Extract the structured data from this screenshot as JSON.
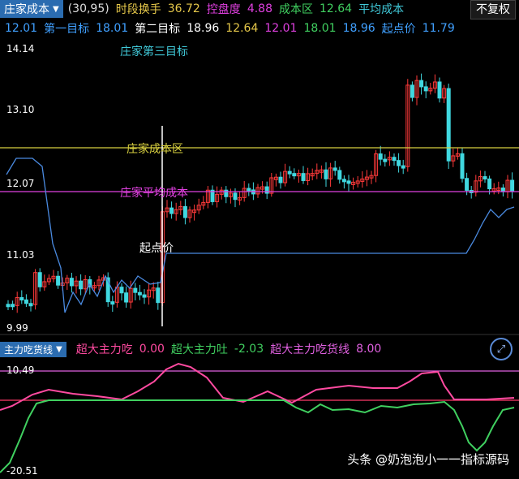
{
  "header": {
    "indicator_name": "庄家成本",
    "params": "(30,95)",
    "items": [
      {
        "label": "时段换手",
        "value": "36.72",
        "color": "#e6c84a"
      },
      {
        "label": "控盘度",
        "value": "4.88",
        "color": "#e040e0"
      },
      {
        "label": "成本区",
        "value": "12.64",
        "color": "#40d060"
      },
      {
        "label": "平均成本",
        "value": "",
        "color": "#40c8d8"
      }
    ],
    "adjust_button": "不复权"
  },
  "header2": {
    "items": [
      {
        "text": "12.01",
        "color": "#40a0ff"
      },
      {
        "text": "第一目标",
        "color": "#40a0ff"
      },
      {
        "text": "18.01",
        "color": "#40a0ff"
      },
      {
        "text": "第二目标",
        "color": "#ffffff"
      },
      {
        "text": "18.96",
        "color": "#ffffff"
      },
      {
        "text": "12.64",
        "color": "#e6c84a"
      },
      {
        "text": "12.01",
        "color": "#e040e0"
      },
      {
        "text": "18.01",
        "color": "#40d060"
      },
      {
        "text": "18.96",
        "color": "#40a0ff"
      },
      {
        "text": "起点价",
        "color": "#40a0ff"
      },
      {
        "text": "11.79",
        "color": "#40a0ff"
      }
    ]
  },
  "price_axis": {
    "top": "14.14",
    "l2": "13.10",
    "l3": "12.07",
    "l4": "11.03",
    "bottom": "9.99"
  },
  "annotations": {
    "third_target": "庄家第三目标",
    "cost_zone": "庄家成本区",
    "avg_cost": "庄家平均成本",
    "start_price": "起点价"
  },
  "sub_panel": {
    "indicator_name": "主力吃货线",
    "items": [
      {
        "label": "超大主力吃",
        "value": "0.00",
        "color": "#ff4aa0"
      },
      {
        "label": "超大主力吐",
        "value": "-2.03",
        "color": "#40d060"
      },
      {
        "label": "超大主力吃货线",
        "value": "8.00",
        "color": "#e060e0"
      }
    ],
    "axis_top": "10.49",
    "axis_bottom": "-20.51"
  },
  "watermark": "头条 @奶泡泡小一一指标源码",
  "colors": {
    "up": "#ff3a3a",
    "down": "#40d8e0",
    "cost": "#d8d040",
    "avg": "#e040e0",
    "blue_line": "#4a8ae0"
  }
}
